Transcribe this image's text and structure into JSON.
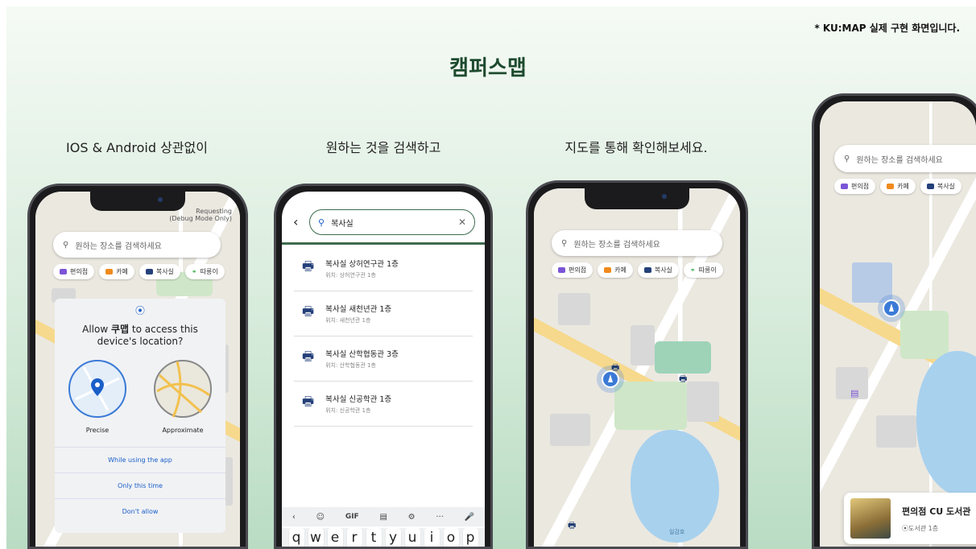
{
  "note": "* KU:MAP 실제 구현 화면입니다.",
  "title": "캠퍼스맵",
  "captions": [
    "IOS & Android 상관없이",
    "원하는 것을 검색하고",
    "지도를 통해 확인해보세요."
  ],
  "search_placeholder": "원하는 장소를 검색하세요",
  "chips": [
    {
      "label": "편의점",
      "color": "#7b55d6"
    },
    {
      "label": "카페",
      "color": "#f08a1c"
    },
    {
      "label": "복사실",
      "color": "#24407a"
    },
    {
      "label": "따릉이",
      "color": "#3fae52"
    }
  ],
  "phone1": {
    "debug": "Requesting\n(Debug Mode Only)",
    "dialog_title_prefix": "Allow ",
    "dialog_app": "쿠맵",
    "dialog_title_suffix": " to access this device's location?",
    "precise": "Precise",
    "approximate": "Approximate",
    "btn_while": "While using the app",
    "btn_once": "Only this time",
    "btn_deny": "Don't allow"
  },
  "phone2": {
    "query": "복사실",
    "results": [
      {
        "title": "복사실 상허연구관 1층",
        "sub": "위치: 상허연구관 1층"
      },
      {
        "title": "복사실 새천년관 1층",
        "sub": "위치: 새천년관 1층"
      },
      {
        "title": "복사실 산학협동관 3층",
        "sub": "위치: 산학협동관 1층"
      },
      {
        "title": "복사실 신공학관 1층",
        "sub": "위치: 신공학관 1층"
      }
    ],
    "kb_tools": [
      "‹",
      "☺",
      "GIF",
      "▤",
      "⚙",
      "···",
      "🎤"
    ],
    "kb_keys": [
      "q",
      "w",
      "e",
      "r",
      "t",
      "y",
      "u",
      "i",
      "o",
      "p"
    ]
  },
  "phone3": {
    "lake": "일감호"
  },
  "phone4": {
    "card_title": "편의점 CU 도서관",
    "card_sub": "도서관 1층"
  }
}
